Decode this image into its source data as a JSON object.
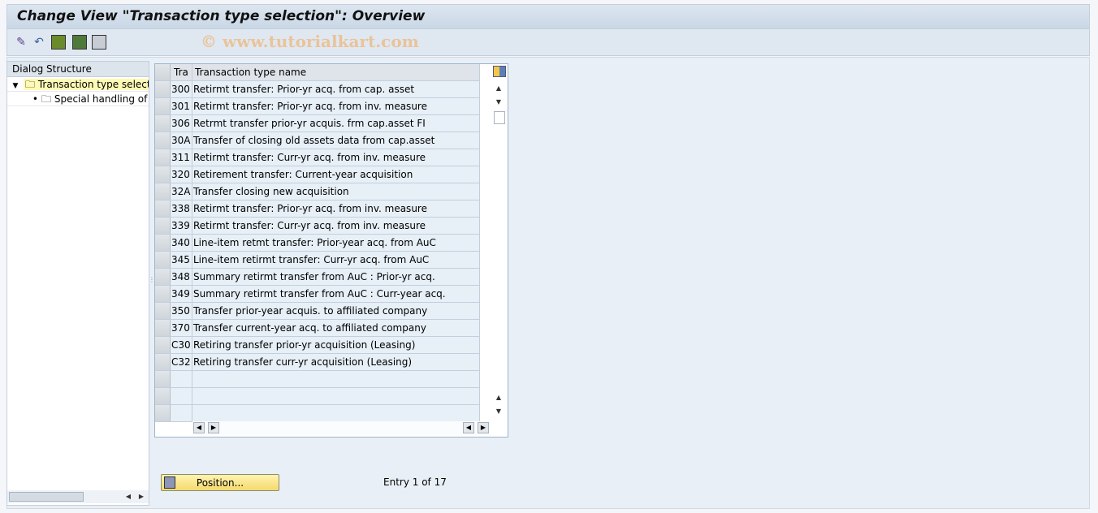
{
  "title": "Change View \"Transaction type selection\": Overview",
  "watermark": "© www.tutorialkart.com",
  "toolbar": {
    "icons": [
      "edit-glasses-icon",
      "undo-icon",
      "select-all-icon",
      "select-block-icon",
      "deselect-all-icon"
    ]
  },
  "dialog_structure": {
    "header": "Dialog Structure",
    "items": [
      {
        "label": "Transaction type selection",
        "selected": true
      },
      {
        "label": "Special handling of transaction types"
      }
    ]
  },
  "table": {
    "columns": [
      "Tra",
      "Transaction type name"
    ],
    "rows": [
      [
        "300",
        "Retirmt transfer: Prior-yr acq. from cap. asset"
      ],
      [
        "301",
        "Retirmt transfer: Prior-yr acq. from inv. measure"
      ],
      [
        "306",
        "Retrmt transfer prior-yr acquis. frm cap.asset  FI"
      ],
      [
        "30A",
        "Transfer of closing old assets data from cap.asset"
      ],
      [
        "311",
        "Retirmt transfer: Curr-yr acq. from inv. measure"
      ],
      [
        "320",
        "Retirement transfer: Current-year acquisition"
      ],
      [
        "32A",
        "Transfer closing new acquisition"
      ],
      [
        "338",
        "Retirmt transfer: Prior-yr acq. from inv. measure"
      ],
      [
        "339",
        "Retirmt transfer: Curr-yr acq. from inv. measure"
      ],
      [
        "340",
        "Line-item retmt transfer: Prior-year acq. from AuC"
      ],
      [
        "345",
        "Line-item retirmt transfer: Curr-yr acq. from AuC"
      ],
      [
        "348",
        "Summary retirmt transfer from AuC : Prior-yr acq."
      ],
      [
        "349",
        "Summary retirmt transfer from AuC : Curr-year acq."
      ],
      [
        "350",
        "Transfer prior-year acquis. to affiliated company"
      ],
      [
        "370",
        "Transfer current-year acq. to affiliated company"
      ],
      [
        "C30",
        "Retiring transfer prior-yr acquisition (Leasing)"
      ],
      [
        "C32",
        "Retiring transfer curr-yr acquisition (Leasing)"
      ],
      [
        "",
        ""
      ],
      [
        "",
        ""
      ],
      [
        "",
        ""
      ]
    ]
  },
  "position_button": "Position...",
  "entry_text": "Entry 1 of 17"
}
